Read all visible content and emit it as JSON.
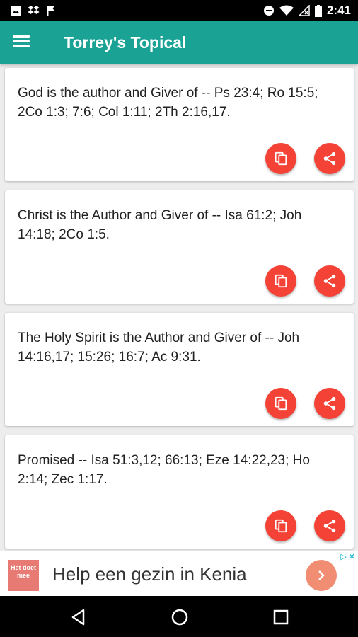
{
  "status_bar": {
    "time": "2:41",
    "left_icons": [
      "image-icon",
      "dropbox-icon",
      "flag-icon"
    ],
    "right_icons": [
      "do-not-disturb-icon",
      "wifi-icon",
      "no-signal-icon",
      "battery-icon"
    ]
  },
  "app_bar": {
    "title": "Torrey's Topical",
    "menu_icon": "hamburger-menu-icon"
  },
  "entries": [
    {
      "text": "God is the author and Giver of -- Ps 23:4; Ro 15:5; 2Co 1:3; 7:6; Col 1:11; 2Th 2:16,17."
    },
    {
      "text": "Christ is the Author and Giver of -- Isa 61:2; Joh 14:18; 2Co 1:5."
    },
    {
      "text": "The Holy Spirit is the Author and Giver of -- Joh 14:16,17; 15:26; 16:7; Ac 9:31."
    },
    {
      "text": "Promised -- Isa 51:3,12; 66:13; Eze 14:22,23; Ho 2:14; Zec 1:17."
    }
  ],
  "card_actions": {
    "copy_icon": "copy-icon",
    "share_icon": "share-icon"
  },
  "ad": {
    "logo_text": "Het doet mee",
    "text": "Help een gezin in Kenia",
    "arrow_icon": "chevron-right-icon",
    "badge_info": "▷",
    "badge_close": "✕"
  },
  "nav_bar": {
    "icons": [
      "back-icon",
      "home-icon",
      "recents-icon"
    ]
  },
  "colors": {
    "primary": "#1aa394",
    "accent": "#f44336",
    "background": "#ededed"
  }
}
